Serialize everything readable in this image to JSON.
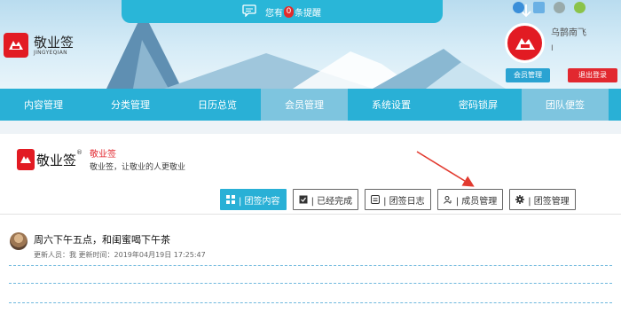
{
  "notice": {
    "prefix": "您有",
    "count": "0",
    "suffix": "条提醒"
  },
  "brand": {
    "name_cn": "敬业签",
    "name_en": "JINGYEQIAN"
  },
  "user": {
    "name": "乌鹊南飞",
    "status": "I"
  },
  "header_buttons": {
    "member": "会员管理",
    "logout": "退出登录"
  },
  "nav": [
    "内容管理",
    "分类管理",
    "日历总览",
    "会员管理",
    "系统设置",
    "密码锁屏",
    "团队便签"
  ],
  "team": {
    "title": "敬业签",
    "slogan": "敬业签，让敬业的人更敬业",
    "logo": "敬业签",
    "reg": "®"
  },
  "tabs": [
    "| 团签内容",
    "| 已经完成",
    "| 团签日志",
    "| 成员管理",
    "| 团签管理"
  ],
  "post": {
    "title": "周六下午五点，和闺蜜喝下午茶",
    "meta": "更新人员：我  更新时间：2019年04月19日 17:25:47"
  },
  "colors": {
    "accent": "#29b0d6",
    "brand_red": "#e21b23",
    "logout_red": "#e2282f",
    "annotation": "#e23a2f"
  }
}
